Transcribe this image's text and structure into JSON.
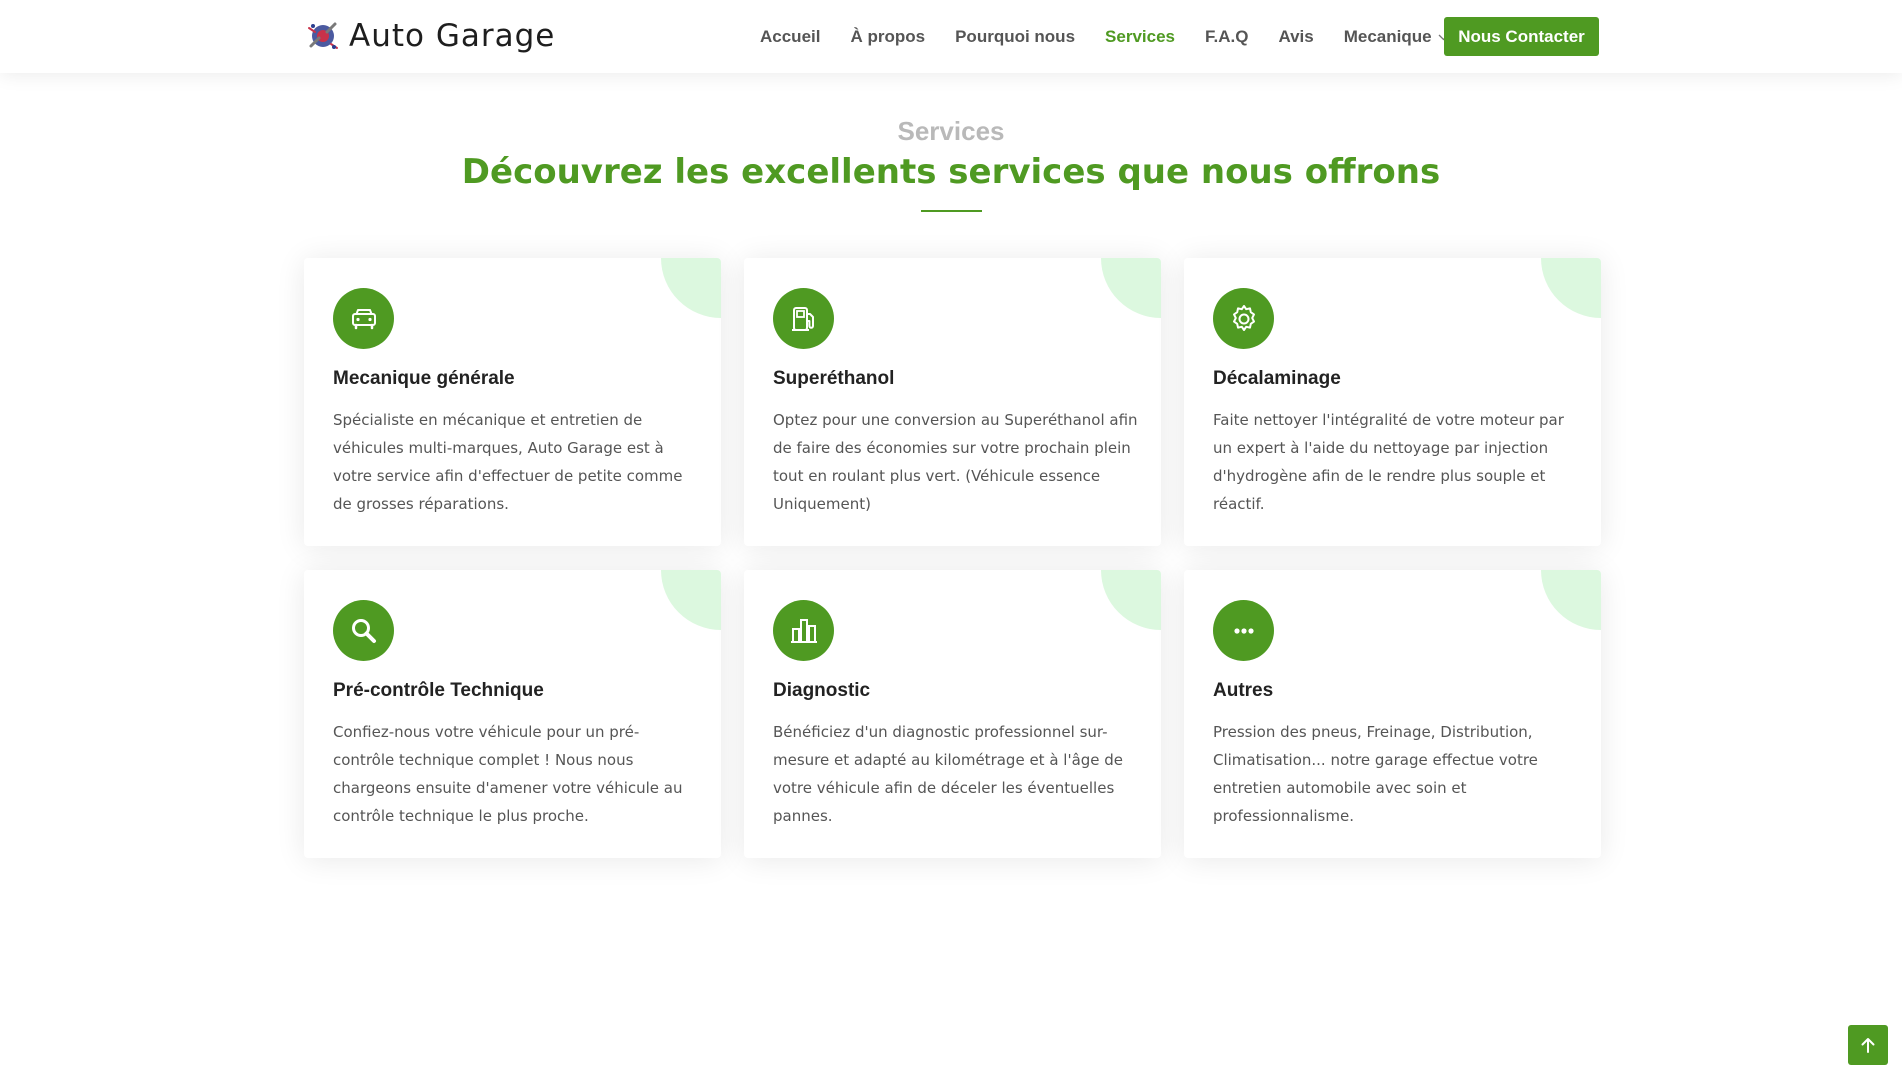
{
  "header": {
    "brand_name": "Auto Garage",
    "brand_logo_icon": "garage-logo",
    "nav": [
      {
        "label": "Accueil",
        "active": false
      },
      {
        "label": "À propos",
        "active": false
      },
      {
        "label": "Pourquoi nous",
        "active": false
      },
      {
        "label": "Services",
        "active": true
      },
      {
        "label": "F.A.Q",
        "active": false
      },
      {
        "label": "Avis",
        "active": false
      },
      {
        "label": "Mecanique",
        "active": false,
        "has_dropdown": true
      }
    ],
    "contact_label": "Nous Contacter"
  },
  "section": {
    "eyebrow": "Services",
    "title": "Découvrez les excellents services que nous offrons"
  },
  "services": [
    {
      "icon": "car-icon",
      "title": "Mecanique générale",
      "text": "Spécialiste en mécanique et entretien de véhicules multi-marques, Auto Garage est à votre service afin d'effectuer de petite comme de grosses réparations."
    },
    {
      "icon": "fuel-pump-icon",
      "title": "Superéthanol",
      "text": "Optez pour une conversion au Superéthanol afin de faire des économies sur votre prochain plein tout en roulant plus vert. (Véhicule essence Uniquement)"
    },
    {
      "icon": "gear-icon",
      "title": "Décalaminage",
      "text": "Faite nettoyer l'intégralité de votre moteur par un expert à l'aide du nettoyage par injection d'hydrogène afin de le rendre plus souple et réactif."
    },
    {
      "icon": "search-icon",
      "title": "Pré-contrôle Technique",
      "text": "Confiez-nous votre véhicule pour un pré-contrôle technique complet ! Nous nous chargeons ensuite d'amener votre véhicule au contrôle technique le plus proche."
    },
    {
      "icon": "bar-chart-icon",
      "title": "Diagnostic",
      "text": "Bénéficiez d'un diagnostic professionnel sur-mesure et adapté au kilométrage et à l'âge de votre véhicule afin de déceler les éventuelles pannes."
    },
    {
      "icon": "more-dots-icon",
      "title": "Autres",
      "text": "Pression des pneus, Freinage, Distribution, Climatisation... notre garage effectue votre entretien automobile avec soin et professionnalisme."
    }
  ],
  "back_to_top_icon": "arrow-up-icon",
  "colors": {
    "accent": "#4f9a22",
    "corner_tint": "#dcf8df",
    "eyebrow": "#b9b9b9"
  }
}
